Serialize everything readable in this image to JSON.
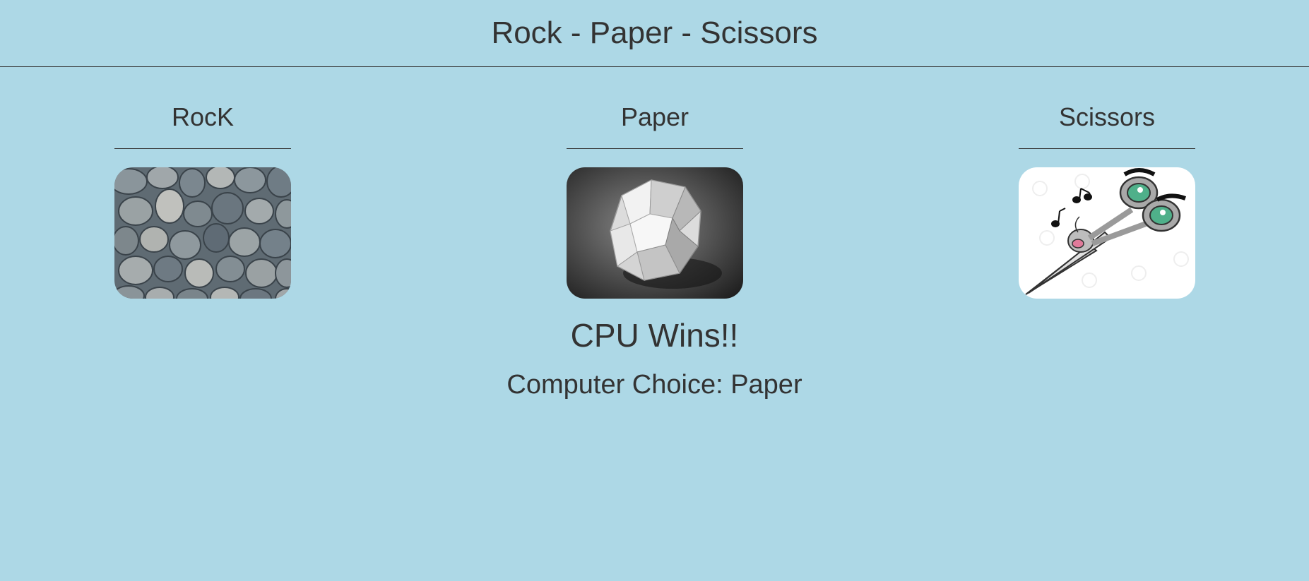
{
  "header": {
    "title": "Rock - Paper - Scissors"
  },
  "choices": [
    {
      "label": "RocK",
      "image": "rock-image"
    },
    {
      "label": "Paper",
      "image": "paper-image"
    },
    {
      "label": "Scissors",
      "image": "scissors-image"
    }
  ],
  "result": {
    "message": "CPU Wins!!",
    "computer_choice_text": "Computer Choice: Paper"
  },
  "colors": {
    "background": "#add8e6",
    "text": "#333333"
  }
}
